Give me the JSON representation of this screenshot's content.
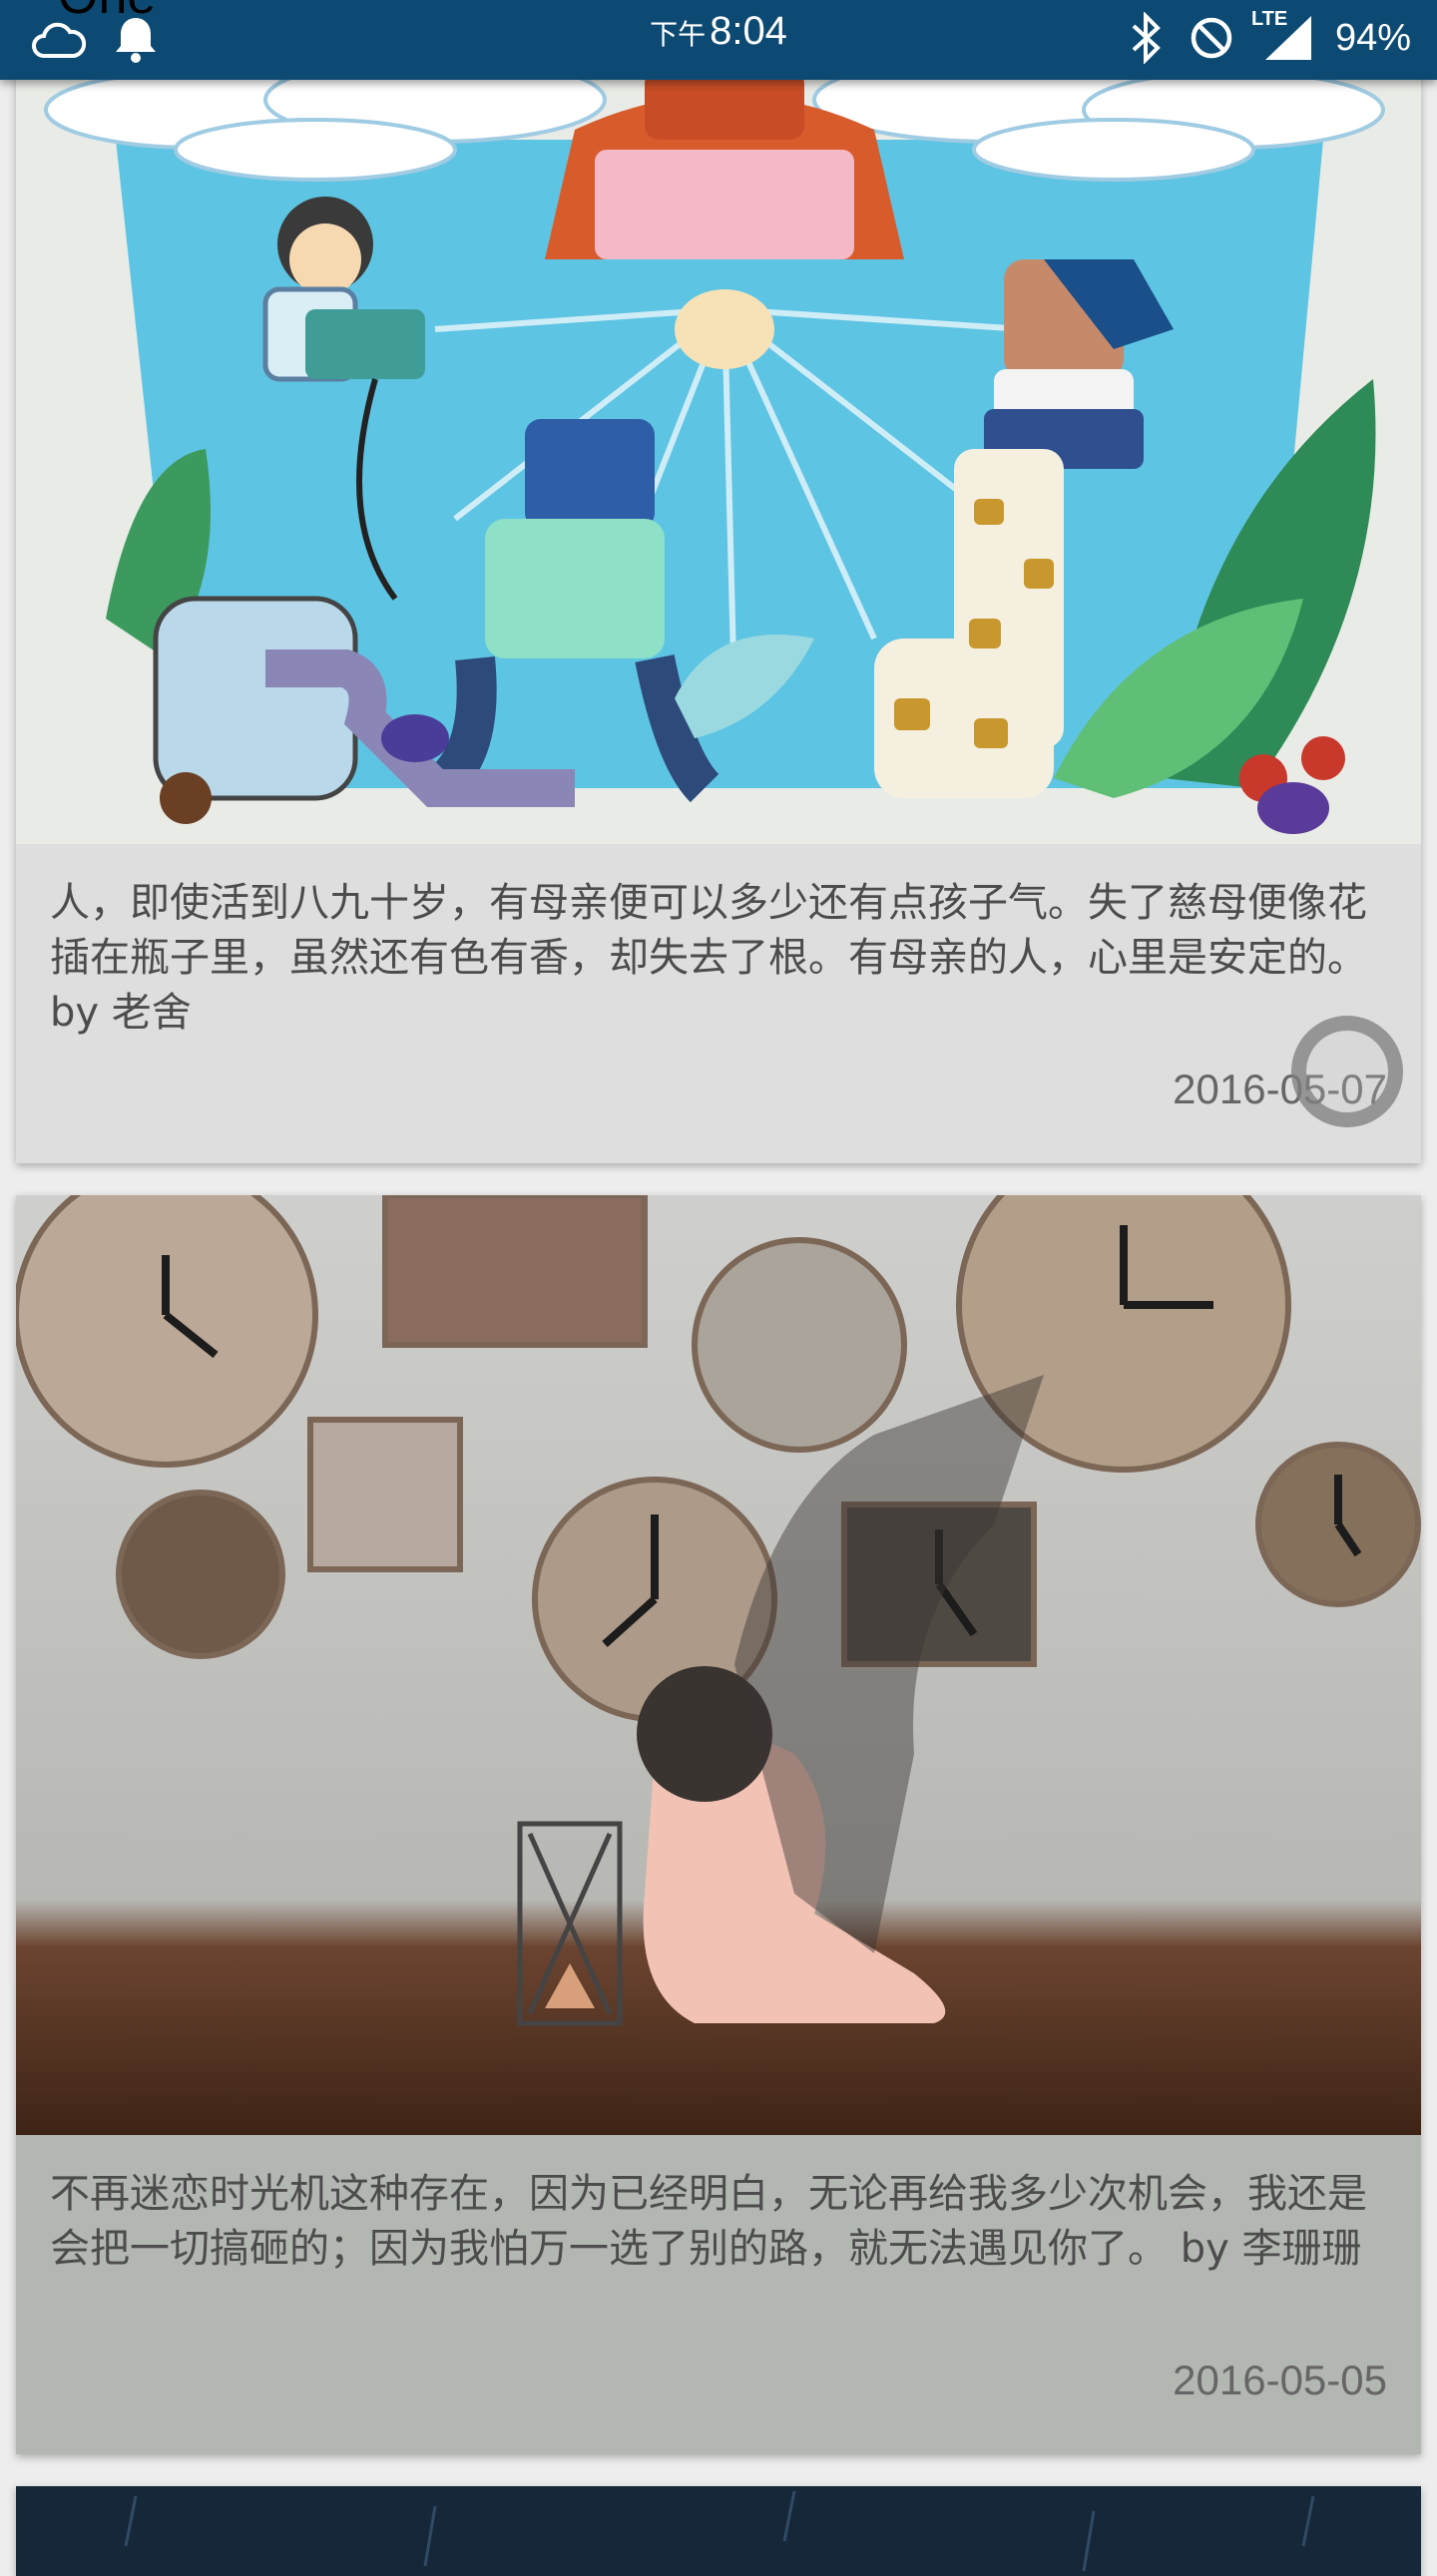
{
  "status_bar": {
    "app_peek": "One",
    "time_prefix": "下午",
    "time": "8:04",
    "network": "LTE",
    "battery": "94%",
    "icons": [
      "cloud-icon",
      "bell-icon",
      "bluetooth-icon",
      "do-not-disturb-icon",
      "signal-icon"
    ]
  },
  "feed": [
    {
      "quote": "人，即使活到八九十岁，有母亲便可以多少还有点孩子气。失了慈母便像花插在瓶子里，虽然还有色有香，却失去了根。有母亲的人，心里是安定的。 by 老舍",
      "date": "2016-05-07",
      "caption_color": "#dedede"
    },
    {
      "quote": "不再迷恋时光机这种存在，因为已经明白，无论再给我多少次机会，我还是会把一切搞砸的；因为我怕万一选了别的路，就无法遇见你了。 by 李珊珊",
      "date": "2016-05-05",
      "caption_color": "#b3b7b1"
    }
  ]
}
